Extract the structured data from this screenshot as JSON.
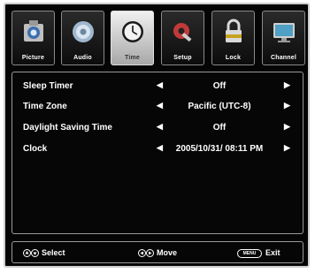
{
  "tabs": [
    {
      "label": "Picture",
      "icon": "camera-icon",
      "active": false
    },
    {
      "label": "Audio",
      "icon": "speaker-icon",
      "active": false
    },
    {
      "label": "Time",
      "icon": "clock-icon",
      "active": true
    },
    {
      "label": "Setup",
      "icon": "gear-wrench-icon",
      "active": false
    },
    {
      "label": "Lock",
      "icon": "padlock-icon",
      "active": false
    },
    {
      "label": "Channel",
      "icon": "monitor-icon",
      "active": false
    }
  ],
  "settings": [
    {
      "name": "Sleep Timer",
      "value": "Off"
    },
    {
      "name": "Time Zone",
      "value": "Pacific (UTC-8)"
    },
    {
      "name": "Daylight Saving Time",
      "value": "Off"
    },
    {
      "name": "Clock",
      "value": "2005/10/31/ 08:11 PM"
    }
  ],
  "footer": {
    "select_label": "Select",
    "move_label": "Move",
    "menu_key": "MENU",
    "exit_label": "Exit"
  },
  "colors": {
    "background": "#050505",
    "text": "#ffffff",
    "border": "#9a9a9a",
    "active_tab": "#d9d9d9"
  }
}
